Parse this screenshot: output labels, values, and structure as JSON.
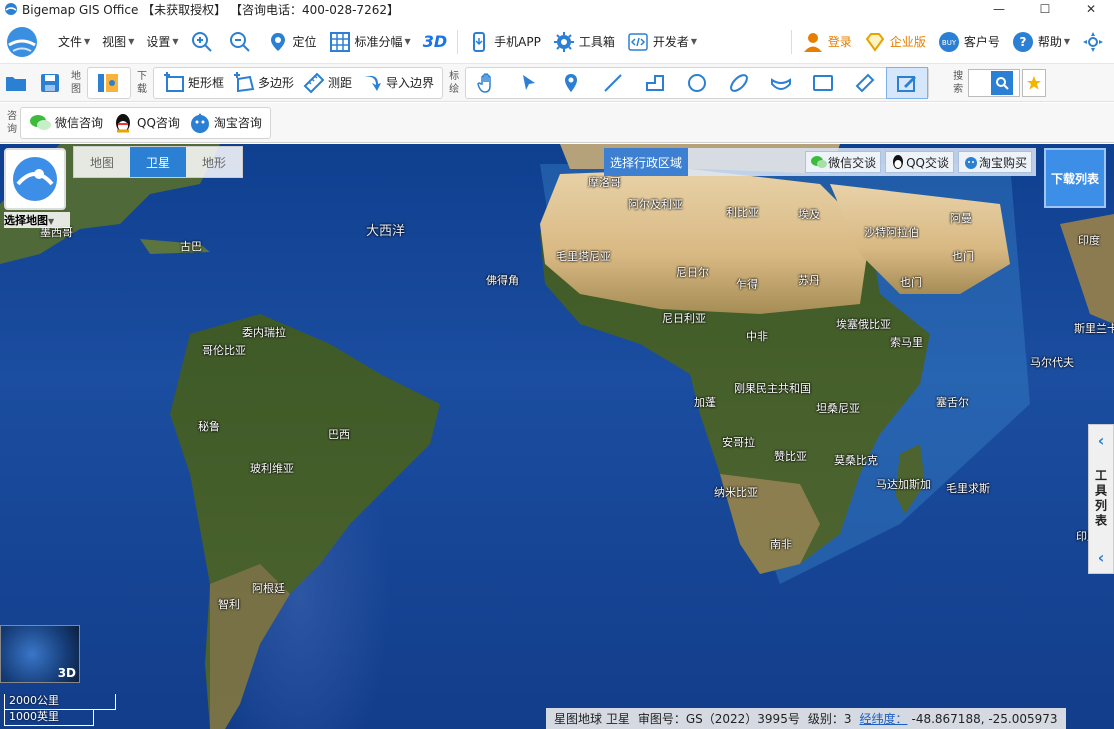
{
  "window": {
    "title": "Bigemap GIS Office 【未获取授权】 【咨询电话：400-028-7262】",
    "minimize": "—",
    "maximize": "☐",
    "close": "✕"
  },
  "menu": {
    "file": "文件",
    "view": "视图",
    "settings": "设置",
    "locate": "定位",
    "tiles": "标准分幅",
    "three_d": "3D",
    "mobile_app": "手机APP",
    "toolbox": "工具箱",
    "developer": "开发者",
    "login": "登录",
    "enterprise": "企业版",
    "customer": "客户号",
    "help": "帮助"
  },
  "toolbar": {
    "map_label": "地图",
    "download_label": "下载",
    "rect": "矩形框",
    "polygon": "多边形",
    "measure": "测距",
    "import_boundary": "导入边界",
    "draw_label": "标绘",
    "search_label": "搜索"
  },
  "toolbar2": {
    "consult_label": "咨询",
    "wechat": "微信咨询",
    "qq": "QQ咨询",
    "taobao": "淘宝咨询"
  },
  "map": {
    "select_map": "选择地图",
    "types": [
      "地图",
      "卫星",
      "地形"
    ],
    "active_type": "卫星",
    "region_label": "选择行政区域",
    "region_wechat": "微信交谈",
    "region_qq": "QQ交谈",
    "region_taobao": "淘宝购买",
    "download_list": "下载列表",
    "tool_list": "工具列表",
    "globe_3d": "3D",
    "scale_km": "2000公里",
    "scale_mi": "1000英里",
    "labels": {
      "atlantic": "大西洋",
      "mexico": "墨西哥",
      "cuba": "古巴",
      "venezuela": "委内瑞拉",
      "colombia": "哥伦比亚",
      "peru": "秘鲁",
      "brazil": "巴西",
      "bolivia": "玻利维亚",
      "argentina": "阿根廷",
      "chile": "智利",
      "cape_verde": "佛得角",
      "morocco": "摩洛哥",
      "algeria": "阿尔及利亚",
      "libya": "利比亚",
      "egypt": "埃及",
      "saudi": "沙特阿拉伯",
      "oman": "阿曼",
      "yemen": "也门",
      "india": "印度",
      "mauritania": "毛里塔尼亚",
      "niger": "尼日尔",
      "chad": "乍得",
      "sudan": "苏丹",
      "nigeria": "尼日利亚",
      "car": "中非",
      "ethiopia": "埃塞俄比亚",
      "somalia": "索马里",
      "drc": "刚果民主共和国",
      "gabon": "加蓬",
      "tanzania": "坦桑尼亚",
      "angola": "安哥拉",
      "zambia": "赞比亚",
      "mozambique": "莫桑比克",
      "namibia": "纳米比亚",
      "south_africa": "南非",
      "madagascar": "马达加斯加",
      "mauritius": "毛里求斯",
      "seychelles": "塞舌尔",
      "maldives": "马尔代夫",
      "sri_lanka": "斯里兰卡",
      "indonesia_partial": "印度"
    }
  },
  "status": {
    "source": "星图地球 卫星",
    "approval": "审图号：GS（2022）3995号",
    "level": "级别：3",
    "coord_label": "经纬度：",
    "coords": "-48.867188, -25.005973"
  }
}
